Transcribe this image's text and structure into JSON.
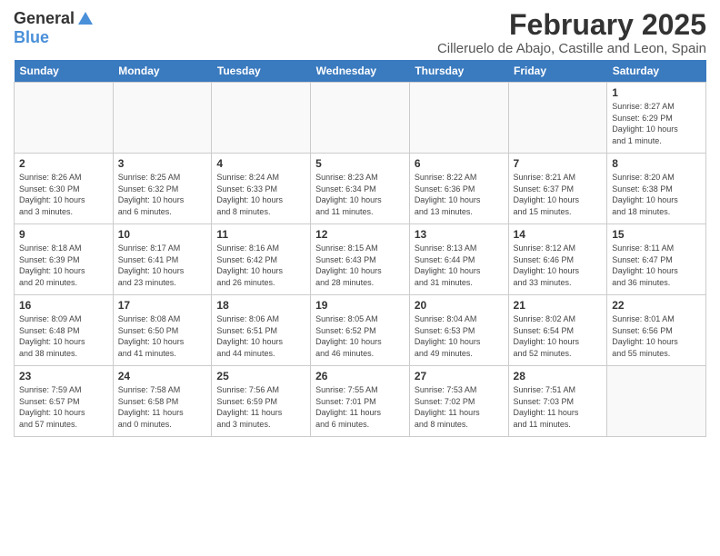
{
  "header": {
    "logo_general": "General",
    "logo_blue": "Blue",
    "month": "February 2025",
    "location": "Cilleruelo de Abajo, Castille and Leon, Spain"
  },
  "days_of_week": [
    "Sunday",
    "Monday",
    "Tuesday",
    "Wednesday",
    "Thursday",
    "Friday",
    "Saturday"
  ],
  "weeks": [
    [
      {
        "day": "",
        "info": ""
      },
      {
        "day": "",
        "info": ""
      },
      {
        "day": "",
        "info": ""
      },
      {
        "day": "",
        "info": ""
      },
      {
        "day": "",
        "info": ""
      },
      {
        "day": "",
        "info": ""
      },
      {
        "day": "1",
        "info": "Sunrise: 8:27 AM\nSunset: 6:29 PM\nDaylight: 10 hours\nand 1 minute."
      }
    ],
    [
      {
        "day": "2",
        "info": "Sunrise: 8:26 AM\nSunset: 6:30 PM\nDaylight: 10 hours\nand 3 minutes."
      },
      {
        "day": "3",
        "info": "Sunrise: 8:25 AM\nSunset: 6:32 PM\nDaylight: 10 hours\nand 6 minutes."
      },
      {
        "day": "4",
        "info": "Sunrise: 8:24 AM\nSunset: 6:33 PM\nDaylight: 10 hours\nand 8 minutes."
      },
      {
        "day": "5",
        "info": "Sunrise: 8:23 AM\nSunset: 6:34 PM\nDaylight: 10 hours\nand 11 minutes."
      },
      {
        "day": "6",
        "info": "Sunrise: 8:22 AM\nSunset: 6:36 PM\nDaylight: 10 hours\nand 13 minutes."
      },
      {
        "day": "7",
        "info": "Sunrise: 8:21 AM\nSunset: 6:37 PM\nDaylight: 10 hours\nand 15 minutes."
      },
      {
        "day": "8",
        "info": "Sunrise: 8:20 AM\nSunset: 6:38 PM\nDaylight: 10 hours\nand 18 minutes."
      }
    ],
    [
      {
        "day": "9",
        "info": "Sunrise: 8:18 AM\nSunset: 6:39 PM\nDaylight: 10 hours\nand 20 minutes."
      },
      {
        "day": "10",
        "info": "Sunrise: 8:17 AM\nSunset: 6:41 PM\nDaylight: 10 hours\nand 23 minutes."
      },
      {
        "day": "11",
        "info": "Sunrise: 8:16 AM\nSunset: 6:42 PM\nDaylight: 10 hours\nand 26 minutes."
      },
      {
        "day": "12",
        "info": "Sunrise: 8:15 AM\nSunset: 6:43 PM\nDaylight: 10 hours\nand 28 minutes."
      },
      {
        "day": "13",
        "info": "Sunrise: 8:13 AM\nSunset: 6:44 PM\nDaylight: 10 hours\nand 31 minutes."
      },
      {
        "day": "14",
        "info": "Sunrise: 8:12 AM\nSunset: 6:46 PM\nDaylight: 10 hours\nand 33 minutes."
      },
      {
        "day": "15",
        "info": "Sunrise: 8:11 AM\nSunset: 6:47 PM\nDaylight: 10 hours\nand 36 minutes."
      }
    ],
    [
      {
        "day": "16",
        "info": "Sunrise: 8:09 AM\nSunset: 6:48 PM\nDaylight: 10 hours\nand 38 minutes."
      },
      {
        "day": "17",
        "info": "Sunrise: 8:08 AM\nSunset: 6:50 PM\nDaylight: 10 hours\nand 41 minutes."
      },
      {
        "day": "18",
        "info": "Sunrise: 8:06 AM\nSunset: 6:51 PM\nDaylight: 10 hours\nand 44 minutes."
      },
      {
        "day": "19",
        "info": "Sunrise: 8:05 AM\nSunset: 6:52 PM\nDaylight: 10 hours\nand 46 minutes."
      },
      {
        "day": "20",
        "info": "Sunrise: 8:04 AM\nSunset: 6:53 PM\nDaylight: 10 hours\nand 49 minutes."
      },
      {
        "day": "21",
        "info": "Sunrise: 8:02 AM\nSunset: 6:54 PM\nDaylight: 10 hours\nand 52 minutes."
      },
      {
        "day": "22",
        "info": "Sunrise: 8:01 AM\nSunset: 6:56 PM\nDaylight: 10 hours\nand 55 minutes."
      }
    ],
    [
      {
        "day": "23",
        "info": "Sunrise: 7:59 AM\nSunset: 6:57 PM\nDaylight: 10 hours\nand 57 minutes."
      },
      {
        "day": "24",
        "info": "Sunrise: 7:58 AM\nSunset: 6:58 PM\nDaylight: 11 hours\nand 0 minutes."
      },
      {
        "day": "25",
        "info": "Sunrise: 7:56 AM\nSunset: 6:59 PM\nDaylight: 11 hours\nand 3 minutes."
      },
      {
        "day": "26",
        "info": "Sunrise: 7:55 AM\nSunset: 7:01 PM\nDaylight: 11 hours\nand 6 minutes."
      },
      {
        "day": "27",
        "info": "Sunrise: 7:53 AM\nSunset: 7:02 PM\nDaylight: 11 hours\nand 8 minutes."
      },
      {
        "day": "28",
        "info": "Sunrise: 7:51 AM\nSunset: 7:03 PM\nDaylight: 11 hours\nand 11 minutes."
      },
      {
        "day": "",
        "info": ""
      }
    ]
  ]
}
